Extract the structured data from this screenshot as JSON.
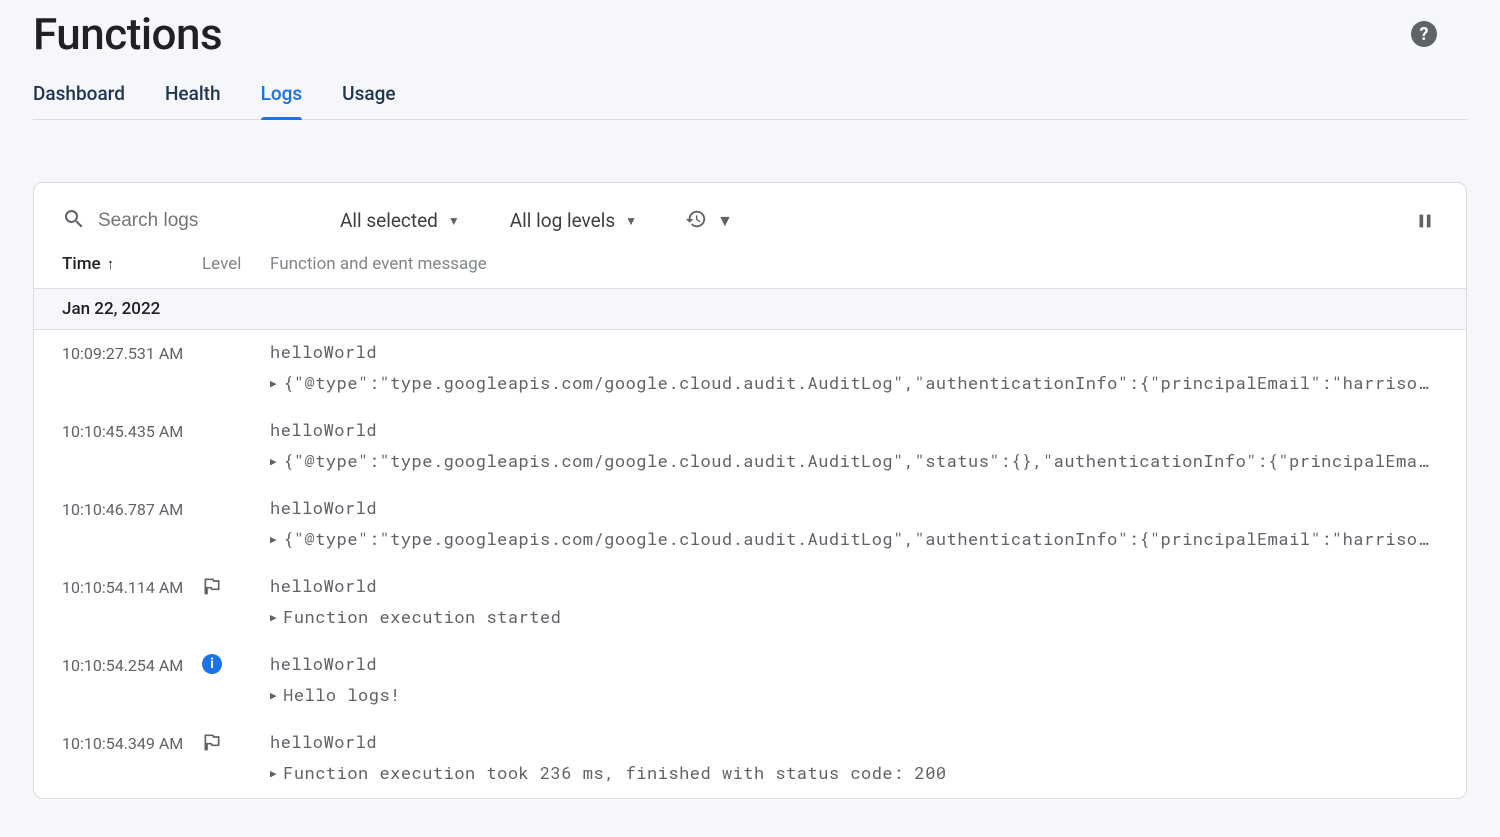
{
  "header": {
    "title": "Functions"
  },
  "tabs": [
    {
      "label": "Dashboard",
      "active": false
    },
    {
      "label": "Health",
      "active": false
    },
    {
      "label": "Logs",
      "active": true
    },
    {
      "label": "Usage",
      "active": false
    }
  ],
  "toolbar": {
    "search_placeholder": "Search logs",
    "filter_functions": "All selected",
    "filter_levels": "All log levels"
  },
  "columns": {
    "time": "Time",
    "level": "Level",
    "message": "Function and event message"
  },
  "date_group": "Jan 22, 2022",
  "entries": [
    {
      "time": "10:09:27.531 AM",
      "level": "none",
      "function": "helloWorld",
      "message": "{\"@type\":\"type.googleapis.com/google.cloud.audit.AuditLog\",\"authenticationInfo\":{\"principalEmail\":\"harrisoncramer@gmail.com\"},\"re…"
    },
    {
      "time": "10:10:45.435 AM",
      "level": "none",
      "function": "helloWorld",
      "message": "{\"@type\":\"type.googleapis.com/google.cloud.audit.AuditLog\",\"status\":{},\"authenticationInfo\":{\"principalEmail\":\"harrisoncramer@gma…"
    },
    {
      "time": "10:10:46.787 AM",
      "level": "none",
      "function": "helloWorld",
      "message": "{\"@type\":\"type.googleapis.com/google.cloud.audit.AuditLog\",\"authenticationInfo\":{\"principalEmail\":\"harrisoncramer@gmail.com\"},\"re…"
    },
    {
      "time": "10:10:54.114 AM",
      "level": "flag",
      "function": "helloWorld",
      "message": "Function execution started"
    },
    {
      "time": "10:10:54.254 AM",
      "level": "info",
      "function": "helloWorld",
      "message": "Hello logs!"
    },
    {
      "time": "10:10:54.349 AM",
      "level": "flag",
      "function": "helloWorld",
      "message": "Function execution took 236 ms, finished with status code: 200"
    }
  ]
}
